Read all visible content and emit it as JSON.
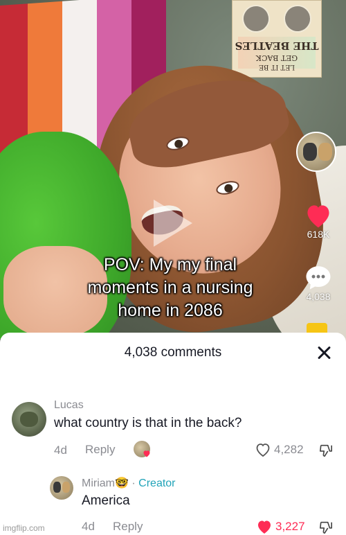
{
  "video": {
    "caption_lines": [
      "POV: My my final",
      "moments in a nursing",
      "home in 2086"
    ],
    "likes": "618K",
    "comments": "4,038",
    "poster_text_1": "THE BEATLES",
    "poster_text_2": "GET BACK",
    "poster_text_3": "LET IT BE",
    "flag_colors": [
      "#c62b36",
      "#ef7a3a",
      "#f4f0ee",
      "#d462a6",
      "#a1205d"
    ]
  },
  "sheet": {
    "title": "4,038 comments"
  },
  "comments": [
    {
      "user": "Lucas",
      "text": "what country is that in the back?",
      "age": "4d",
      "reply_label": "Reply",
      "likes": "4,282"
    },
    {
      "user": "Miriam🤓",
      "separator": "·",
      "badge": "Creator",
      "text": "America",
      "age": "4d",
      "reply_label": "Reply",
      "likes": "3,227"
    }
  ],
  "colors": {
    "heart_red": "#fe2c55",
    "creator_teal": "#20a3b8",
    "muted": "#8a8b91"
  },
  "watermark": "imgflip.com"
}
